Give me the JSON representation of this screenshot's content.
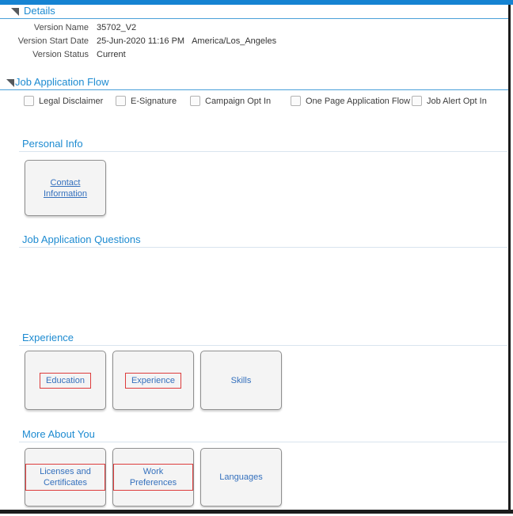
{
  "window": {
    "top_bar_color": "#1583d2",
    "frame_color": "#1c1c1c",
    "header_blue": "#1d8bd1",
    "link_blue": "#3470bd",
    "annotation_red": "#dd3c3c"
  },
  "icons": {
    "disclosure": "expanded-disclosure-triangle"
  },
  "details_section": {
    "title": "Details",
    "fields": [
      {
        "label": "Version Name",
        "value": "35702_V2"
      },
      {
        "label": "Version Start Date",
        "value": "25-Jun-2020 11:16 PM",
        "timezone": "America/Los_Angeles"
      },
      {
        "label": "Version Status",
        "value": "Current"
      }
    ]
  },
  "flow_section": {
    "title": "Job Application Flow",
    "checkboxes": [
      {
        "label": "Legal Disclaimer",
        "checked": false
      },
      {
        "label": "E-Signature",
        "checked": false
      },
      {
        "label": "Campaign Opt In",
        "checked": false
      },
      {
        "label": "One Page Application Flow",
        "checked": false
      },
      {
        "label": "Job Alert Opt In",
        "checked": false
      }
    ]
  },
  "blocks": [
    {
      "title": "Personal Info",
      "cards": [
        {
          "label": "Contact Information",
          "underlined": true,
          "red_outline": false
        }
      ]
    },
    {
      "title": "Job Application Questions",
      "cards": []
    },
    {
      "title": "Experience",
      "cards": [
        {
          "label": "Education",
          "red_outline": true
        },
        {
          "label": "Experience",
          "red_outline": true
        },
        {
          "label": "Skills",
          "red_outline": false
        }
      ]
    },
    {
      "title": "More About You",
      "cards": [
        {
          "label": "Licenses and Certificates",
          "red_outline": true
        },
        {
          "label": "Work Preferences",
          "red_outline": true
        },
        {
          "label": "Languages",
          "red_outline": false
        }
      ]
    }
  ]
}
